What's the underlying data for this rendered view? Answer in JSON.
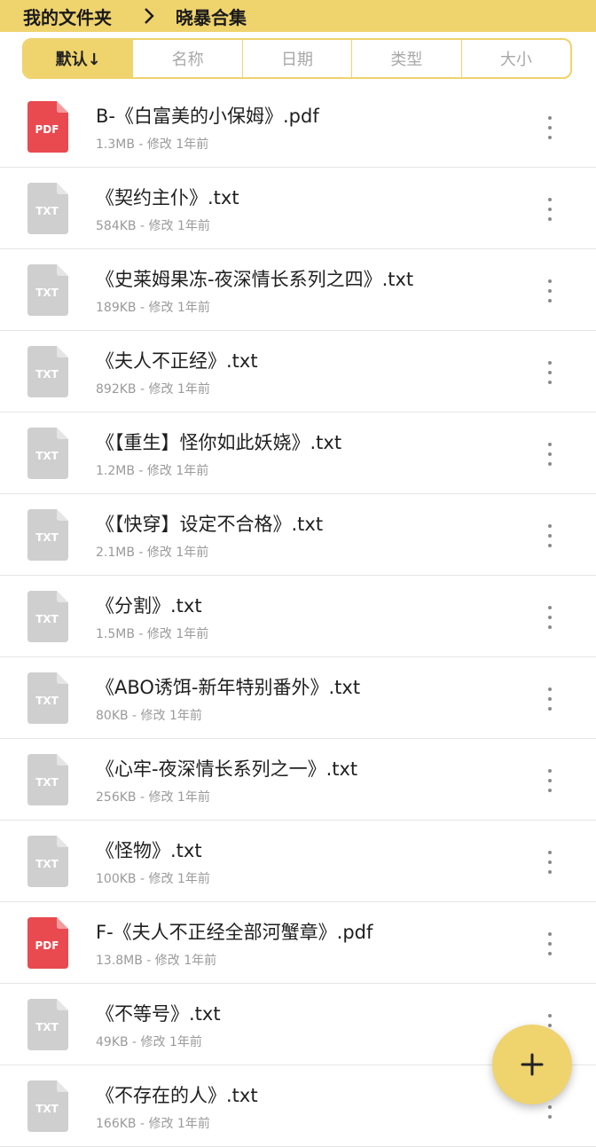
{
  "breadcrumb": {
    "root": "我的文件夹",
    "current": "晓暴合集"
  },
  "sort_tabs": [
    {
      "label": "默认↓",
      "active": true
    },
    {
      "label": "名称",
      "active": false
    },
    {
      "label": "日期",
      "active": false
    },
    {
      "label": "类型",
      "active": false
    },
    {
      "label": "大小",
      "active": false
    }
  ],
  "files": [
    {
      "type": "pdf",
      "icon_label": "PDF",
      "name": "B-《白富美的小保姆》.pdf",
      "meta": "1.3MB - 修改 1年前"
    },
    {
      "type": "txt",
      "icon_label": "TXT",
      "name": "《契约主仆》.txt",
      "meta": "584KB - 修改 1年前"
    },
    {
      "type": "txt",
      "icon_label": "TXT",
      "name": "《史莱姆果冻-夜深情长系列之四》.txt",
      "meta": "189KB - 修改 1年前"
    },
    {
      "type": "txt",
      "icon_label": "TXT",
      "name": "《夫人不正经》.txt",
      "meta": "892KB - 修改 1年前"
    },
    {
      "type": "txt",
      "icon_label": "TXT",
      "name": "《【重生】怪你如此妖娆》.txt",
      "meta": "1.2MB - 修改 1年前"
    },
    {
      "type": "txt",
      "icon_label": "TXT",
      "name": "《【快穿】设定不合格》.txt",
      "meta": "2.1MB - 修改 1年前"
    },
    {
      "type": "txt",
      "icon_label": "TXT",
      "name": "《分割》.txt",
      "meta": "1.5MB - 修改 1年前"
    },
    {
      "type": "txt",
      "icon_label": "TXT",
      "name": "《ABO诱饵-新年特别番外》.txt",
      "meta": "80KB - 修改 1年前"
    },
    {
      "type": "txt",
      "icon_label": "TXT",
      "name": "《心牢-夜深情长系列之一》.txt",
      "meta": "256KB - 修改 1年前"
    },
    {
      "type": "txt",
      "icon_label": "TXT",
      "name": "《怪物》.txt",
      "meta": "100KB - 修改 1年前"
    },
    {
      "type": "pdf",
      "icon_label": "PDF",
      "name": "F-《夫人不正经全部河蟹章》.pdf",
      "meta": "13.8MB - 修改 1年前"
    },
    {
      "type": "txt",
      "icon_label": "TXT",
      "name": "《不等号》.txt",
      "meta": "49KB - 修改 1年前"
    },
    {
      "type": "txt",
      "icon_label": "TXT",
      "name": "《不存在的人》.txt",
      "meta": "166KB - 修改 1年前"
    }
  ],
  "fab": {
    "icon": "plus-icon"
  },
  "colors": {
    "accent": "#efd36d",
    "pdf": "#e84a4f",
    "txt": "#cfcfcf"
  }
}
